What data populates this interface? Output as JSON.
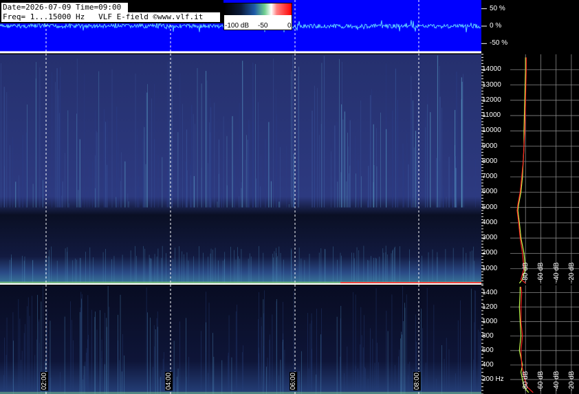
{
  "header": {
    "line1": "Date=2026-07-09 Time=09:00",
    "line2": "Freq= 1...15000 Hz   VLF E-field ©www.vlf.it"
  },
  "colorbar": {
    "labels": [
      "-100 dB",
      "-50",
      "0"
    ],
    "colors": [
      "#000000",
      "#1e5aa8",
      "#6fcf8f",
      "#ffffff",
      "#ff0000"
    ]
  },
  "colors": {
    "waveform_bg": "#0000ff",
    "spectrogram_bg": "#060a1f",
    "avg_curve": "#c8ff50",
    "peak_curve": "#ff2020",
    "grid": "#ffffff"
  },
  "chart_data": [
    {
      "type": "line",
      "panel": "waveform",
      "y_tick_labels": [
        "50 %",
        "0 %",
        "-50 %"
      ],
      "ylim": [
        -75,
        75
      ],
      "grid": true
    },
    {
      "type": "heatmap",
      "panel": "spectrogram-full",
      "x_tick_labels": [
        "02:00",
        "04:00",
        "06:00",
        "08:00"
      ],
      "y_tick_labels": [
        "1000",
        "2000",
        "3000",
        "4000",
        "5000",
        "6000",
        "7000",
        "8000",
        "9000",
        "10000",
        "11000",
        "12000",
        "13000",
        "14000"
      ],
      "ylim": [
        0,
        15000
      ],
      "grid": true
    },
    {
      "type": "line",
      "panel": "spectrum-full",
      "x_tick_labels": [
        "-80 dB",
        "-60 dB",
        "-40 dB",
        "-20 dB"
      ],
      "xlim": [
        -100,
        -10
      ],
      "ylim": [
        0,
        15000
      ],
      "series": [
        {
          "x": [
            -88,
            -84,
            -80,
            -82,
            -86,
            -88,
            -90,
            -89,
            -86,
            -84,
            -83,
            -82,
            -82,
            -81,
            -80,
            -80
          ],
          "y": [
            50,
            300,
            1000,
            2000,
            3000,
            4000,
            4800,
            5200,
            6000,
            7000,
            8000,
            9000,
            10000,
            12000,
            14000,
            14800
          ]
        },
        {
          "x": [
            -80,
            -86,
            -82,
            -84,
            -87,
            -89,
            -91,
            -90,
            -87,
            -85,
            -83,
            -82,
            -81,
            -80,
            -79,
            -79
          ],
          "y": [
            50,
            300,
            1000,
            2000,
            3000,
            4000,
            4800,
            5200,
            6000,
            7000,
            8000,
            9000,
            10000,
            12000,
            14000,
            14800
          ]
        }
      ]
    },
    {
      "type": "heatmap",
      "panel": "spectrogram-low",
      "x_tick_labels": [
        "02:00",
        "04:00",
        "06:00",
        "08:00"
      ],
      "y_tick_labels": [
        "200 Hz",
        "400",
        "600",
        "800",
        "1000",
        "1200",
        "1400"
      ],
      "ylim": [
        0,
        1500
      ],
      "grid": true
    },
    {
      "type": "line",
      "panel": "spectrum-low",
      "x_tick_labels": [
        "-80 dB",
        "-60 dB",
        "-40 dB",
        "-20 dB"
      ],
      "xlim": [
        -100,
        -10
      ],
      "ylim": [
        0,
        1500
      ],
      "series": [
        {
          "x": [
            -76,
            -82,
            -84,
            -86,
            -84,
            -88,
            -87,
            -86,
            -87,
            -88,
            -87,
            -87
          ],
          "y": [
            20,
            100,
            200,
            300,
            400,
            600,
            700,
            800,
            1000,
            1200,
            1400,
            1480
          ]
        },
        {
          "x": [
            -70,
            -78,
            -81,
            -83,
            -85,
            -86,
            -85,
            -84,
            -86,
            -86,
            -85,
            -86
          ],
          "y": [
            20,
            100,
            200,
            300,
            400,
            600,
            700,
            800,
            1000,
            1200,
            1400,
            1480
          ]
        }
      ]
    }
  ]
}
